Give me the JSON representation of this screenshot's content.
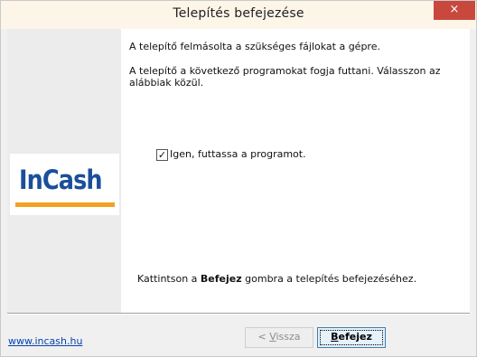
{
  "window": {
    "title": "Telepítés befejezése",
    "close_glyph": "×"
  },
  "logo": {
    "brand": "InCash"
  },
  "content": {
    "line1": "A telepítő felmásolta a szükséges fájlokat a gépre.",
    "line2": "A telepítő a következő programokat fogja futtani. Válasszon az alábbiak közül.",
    "checkbox_label": "Igen, futtassa a programot.",
    "checkbox_checked": true,
    "finish_prefix": "Kattintson a ",
    "finish_bold": "Befejez",
    "finish_suffix": " gombra a telepítés befejezéséhez."
  },
  "footer": {
    "link": "www.incash.hu",
    "back_u": "V",
    "back_rest": "issza",
    "back_prefix": "< ",
    "finish_u": "B",
    "finish_rest": "efejez"
  },
  "colors": {
    "accent": "#1a4f9a",
    "logo_bar": "#f5a121",
    "close": "#c9483e",
    "link": "#0645ad"
  }
}
